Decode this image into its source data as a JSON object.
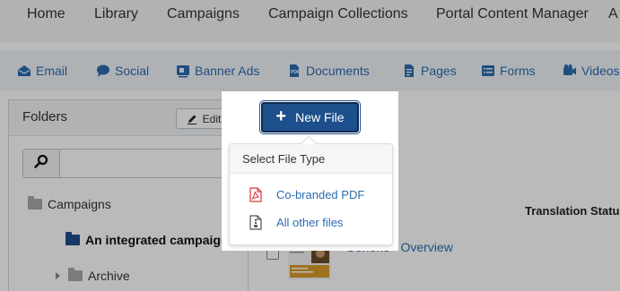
{
  "topnav": {
    "items": [
      "Home",
      "Library",
      "Campaigns",
      "Campaign Collections",
      "Portal Content Manager",
      "A"
    ]
  },
  "tabs": [
    {
      "label": "Email",
      "icon": "email-icon"
    },
    {
      "label": "Social",
      "icon": "chat-bubble-icon"
    },
    {
      "label": "Banner Ads",
      "icon": "banner-icon"
    },
    {
      "label": "Documents",
      "icon": "pdf-document-icon"
    },
    {
      "label": "Pages",
      "icon": "page-icon"
    },
    {
      "label": "Forms",
      "icon": "form-icon"
    },
    {
      "label": "Videos",
      "icon": "video-camera-icon"
    }
  ],
  "folders_panel": {
    "title": "Folders",
    "edit_label": "Edit",
    "search_placeholder": "",
    "tree": [
      {
        "label": "Campaigns"
      },
      {
        "label": "An integrated campaign"
      },
      {
        "label": "Archive"
      }
    ]
  },
  "main": {
    "new_file_label": "New File",
    "column_translation_status": "Translation Statu",
    "row": {
      "title": "Generic - Overview"
    }
  },
  "popover": {
    "title": "Select File Type",
    "options": [
      {
        "label": "Co-branded PDF",
        "icon": "pdf-file-icon"
      },
      {
        "label": "All other files",
        "icon": "generic-file-icon"
      }
    ]
  },
  "colors": {
    "accent": "#1d4f8c",
    "link": "#2b6cb0",
    "pdf_icon": "#d9363e"
  }
}
